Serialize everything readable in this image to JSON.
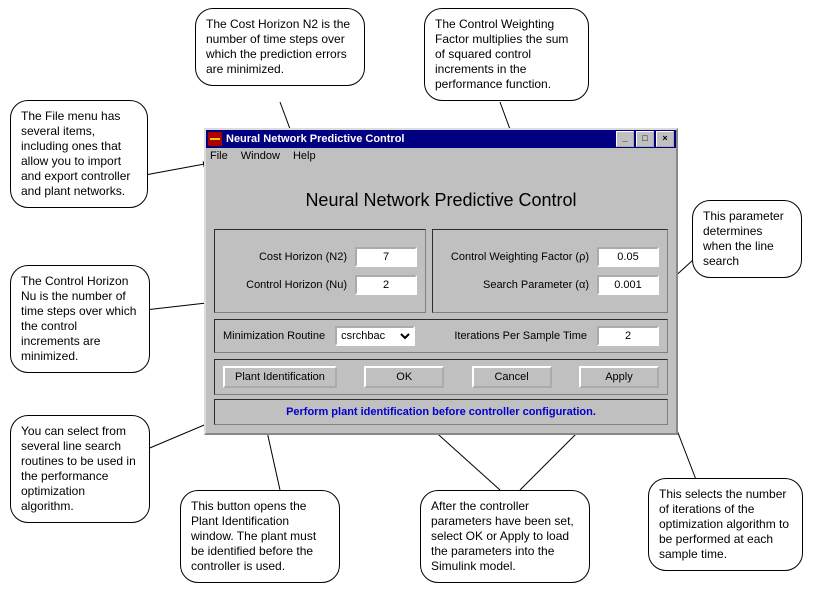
{
  "window": {
    "title": "Neural Network Predictive Control",
    "minimize": "_",
    "maximize": "□",
    "close": "×"
  },
  "menubar": {
    "file": "File",
    "window": "Window",
    "help": "Help"
  },
  "heading": "Neural Network Predictive Control",
  "params": {
    "cost_horizon_label": "Cost Horizon (N2)",
    "cost_horizon_value": "7",
    "control_horizon_label": "Control Horizon (Nu)",
    "control_horizon_value": "2",
    "weighting_label": "Control Weighting Factor (ρ)",
    "weighting_value": "0.05",
    "search_param_label": "Search Parameter (α)",
    "search_param_value": "0.001",
    "min_routine_label": "Minimization Routine",
    "min_routine_value": "csrchbac",
    "iter_label": "Iterations Per Sample Time",
    "iter_value": "2"
  },
  "buttons": {
    "plant_id": "Plant Identification",
    "ok": "OK",
    "cancel": "Cancel",
    "apply": "Apply"
  },
  "status_message": "Perform plant identification before controller configuration.",
  "callouts": {
    "c_file": "The File menu has several items, including ones that allow you to import and export controller and plant networks.",
    "c_n2": "The Cost Horizon N2 is the number of time steps over which the prediction errors are minimized.",
    "c_rho": "The Control Weighting Factor multiplies the sum of squared control increments in the performance function.",
    "c_alpha": "This parameter determines when the line search",
    "c_nu": "The Control Horizon Nu is the number of time steps over which the control increments are minimized.",
    "c_search": "You can select from several line search routines to be used in the performance optimization algorithm.",
    "c_plantid": "This button opens the Plant Identification window. The plant must be identified before the controller is used.",
    "c_okapply": "After the controller parameters have been set, select OK or Apply to load the parameters into the Simulink model.",
    "c_iter": "This selects the number of iterations of the optimization algorithm to be performed at each sample time."
  }
}
